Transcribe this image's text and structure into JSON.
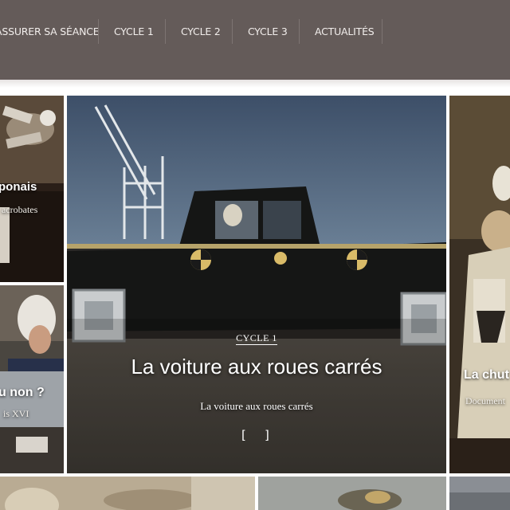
{
  "nav": {
    "items": [
      {
        "label": "ASSURER SA SÉANCE"
      },
      {
        "label": "CYCLE 1"
      },
      {
        "label": "CYCLE 2"
      },
      {
        "label": "CYCLE 3"
      },
      {
        "label": "ACTUALITÉS"
      }
    ]
  },
  "tiles": {
    "top_left": {
      "title": "ponais",
      "subtitle": "acrobates"
    },
    "mid_left": {
      "title": "u non ?",
      "subtitle": "is XVI"
    },
    "featured": {
      "category": "CYCLE 1",
      "title": "La voiture aux roues carrés",
      "subtitle": "La voiture aux roues carrés",
      "control_left": "[",
      "control_right": "]"
    },
    "right": {
      "title": "La chut",
      "subtitle": "Document"
    }
  },
  "colors": {
    "nav_background": "#645b59",
    "nav_text": "#f2eeec"
  }
}
